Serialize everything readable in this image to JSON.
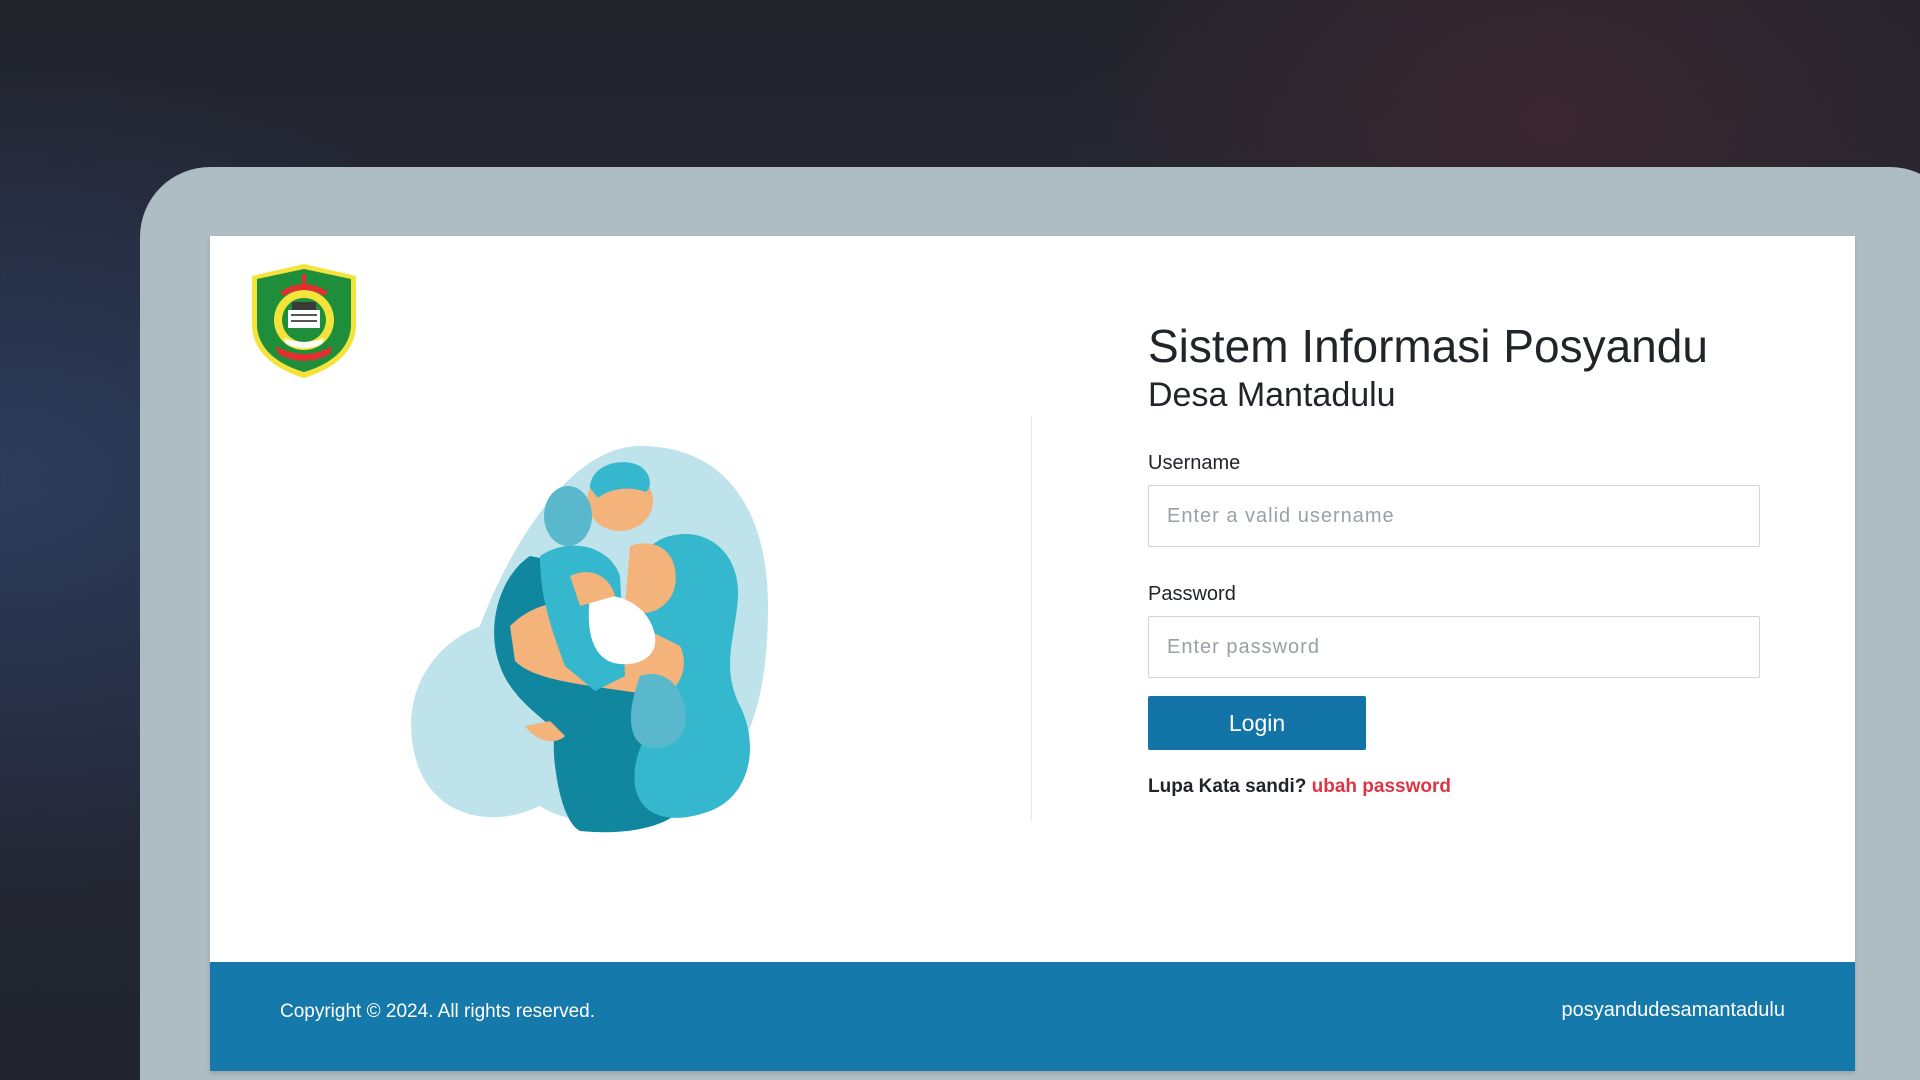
{
  "header": {
    "logo_icon": "regional-emblem-icon",
    "title": "Sistem Informasi Posyandu",
    "subtitle": "Desa Mantadulu"
  },
  "illustration": {
    "icon": "mother-child-illustration",
    "colors": {
      "teal_dark": "#10879f",
      "teal_light": "#35b7ce",
      "blob": "#bfe3ea",
      "skin": "#f4b37a"
    }
  },
  "login_form": {
    "username_label": "Username",
    "username_placeholder": "Enter a valid username",
    "username_value": "",
    "password_label": "Password",
    "password_placeholder": "Enter password",
    "password_value": "",
    "login_button": "Login",
    "forgot_prefix": "Lupa Kata sandi?",
    "forgot_link": "ubah password"
  },
  "footer": {
    "copyright": "Copyright © 2024. All rights reserved.",
    "site_name": "posyandudesamantadulu"
  },
  "colors": {
    "primary": "#1374a8",
    "footer_bg": "#1579ab",
    "link": "#dc3545",
    "frame": "#aebcc4"
  }
}
